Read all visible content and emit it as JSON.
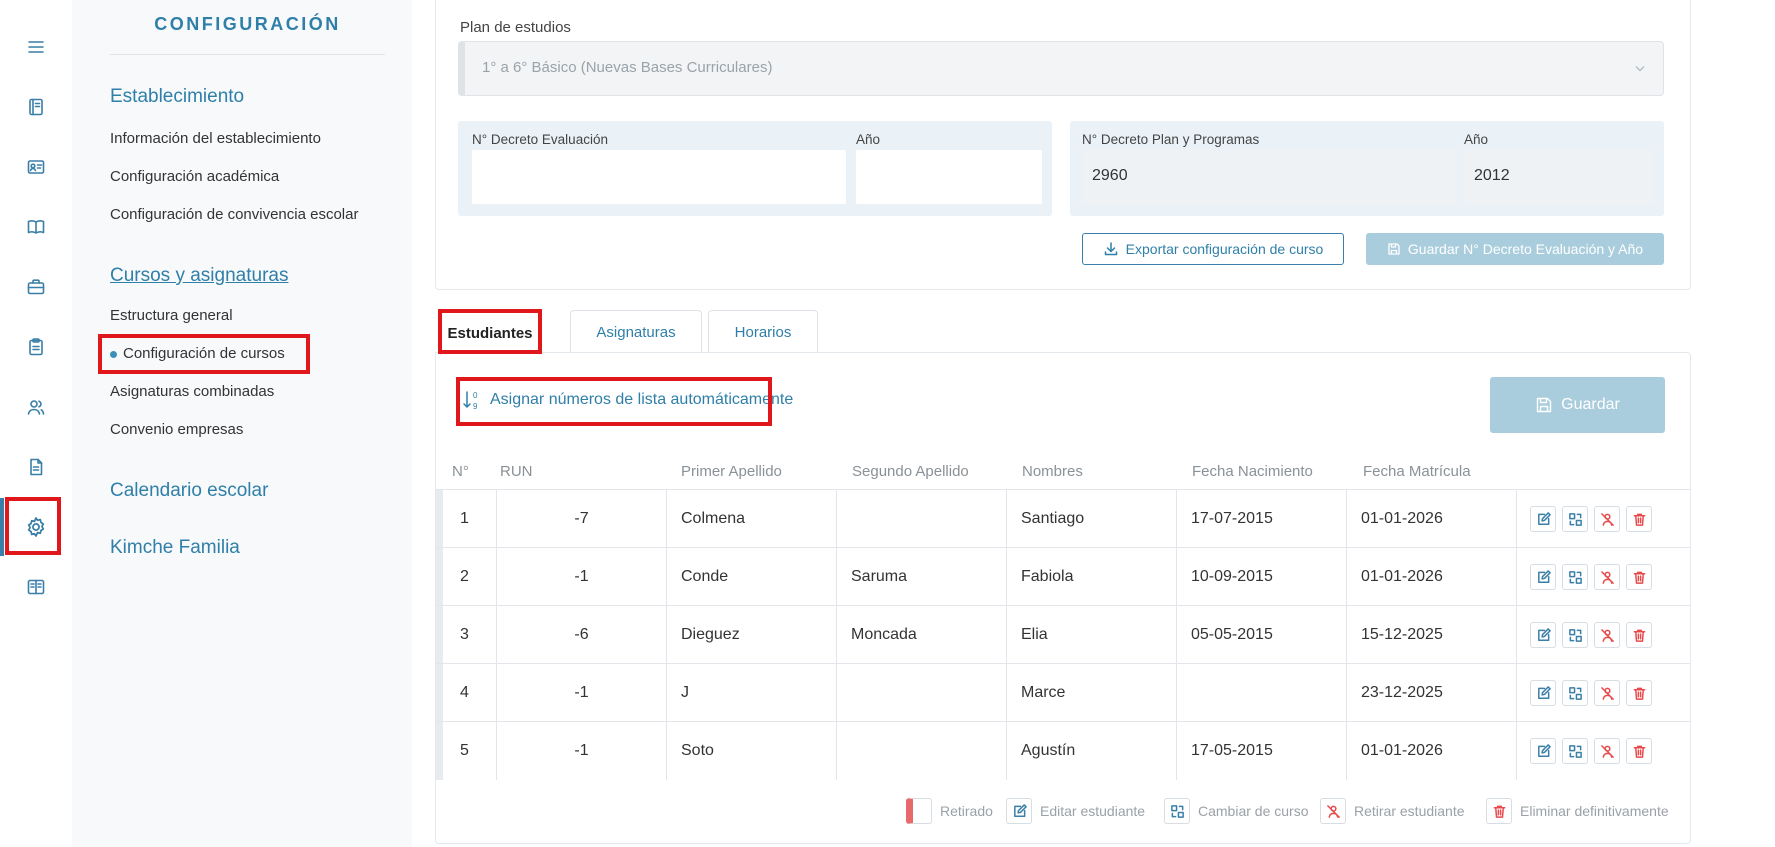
{
  "sidebar": {
    "title": "CONFIGURACIÓN",
    "groups": [
      {
        "label": "Establecimiento",
        "items": [
          "Información del establecimiento",
          "Configuración académica",
          "Configuración de convivencia escolar"
        ]
      },
      {
        "label": "Cursos y asignaturas",
        "items": [
          "Estructura general",
          "Configuración de cursos",
          "Asignaturas combinadas",
          "Convenio empresas"
        ]
      },
      {
        "label": "Calendario escolar",
        "items": []
      },
      {
        "label": "Kimche Familia",
        "items": []
      }
    ],
    "active_item": "Configuración de cursos"
  },
  "rail": {
    "icons": [
      "menu-icon",
      "gradebook-icon",
      "id-card-icon",
      "book-icon",
      "briefcase-icon",
      "clipboard-icon",
      "users-icon",
      "document-icon",
      "settings-icon",
      "book-open-icon"
    ],
    "active": "settings-icon"
  },
  "config": {
    "plan_label": "Plan de estudios",
    "plan_value": "1° a 6° Básico (Nuevas Bases Curriculares)",
    "decreto_eval_label": "N° Decreto Evaluación",
    "decreto_eval_value": "",
    "anio_label": "Año",
    "anio_eval_value": "",
    "decreto_plan_label": "N° Decreto Plan y Programas",
    "decreto_plan_value": "2960",
    "anio_plan_label": "Año",
    "anio_plan_value": "2012",
    "export_button": "Exportar configuración de curso",
    "save_decreto_button": "Guardar N° Decreto Evaluación y Año"
  },
  "tabs": [
    "Estudiantes",
    "Asignaturas",
    "Horarios"
  ],
  "active_tab": "Estudiantes",
  "students": {
    "assign_link": "Asignar números de lista automáticamente",
    "save_button": "Guardar",
    "columns": [
      "N°",
      "RUN",
      "Primer Apellido",
      "Segundo Apellido",
      "Nombres",
      "Fecha Nacimiento",
      "Fecha Matrícula"
    ],
    "rows": [
      {
        "n": "1",
        "run": "-7",
        "apellido1": "Colmena",
        "apellido2": "",
        "nombres": "Santiago",
        "nacimiento": "17-07-2015",
        "matricula": "01-01-2026"
      },
      {
        "n": "2",
        "run": "-1",
        "apellido1": "Conde",
        "apellido2": "Saruma",
        "nombres": "Fabiola",
        "nacimiento": "10-09-2015",
        "matricula": "01-01-2026"
      },
      {
        "n": "3",
        "run": "-6",
        "apellido1": "Dieguez",
        "apellido2": "Moncada",
        "nombres": "Elia",
        "nacimiento": "05-05-2015",
        "matricula": "15-12-2025"
      },
      {
        "n": "4",
        "run": "-1",
        "apellido1": "J",
        "apellido2": "",
        "nombres": "Marce",
        "nacimiento": "",
        "matricula": "23-12-2025"
      },
      {
        "n": "5",
        "run": "-1",
        "apellido1": "Soto",
        "apellido2": "",
        "nombres": "Agustín",
        "nacimiento": "17-05-2015",
        "matricula": "01-01-2026"
      }
    ]
  },
  "legend": [
    "Retirado",
    "Editar estudiante",
    "Cambiar de curso",
    "Retirar estudiante",
    "Eliminar definitivamente"
  ],
  "colors": {
    "accent": "#2f7fa8",
    "highlight": "#e0181c",
    "danger": "#e8494b",
    "disabled": "#a9cddd"
  }
}
